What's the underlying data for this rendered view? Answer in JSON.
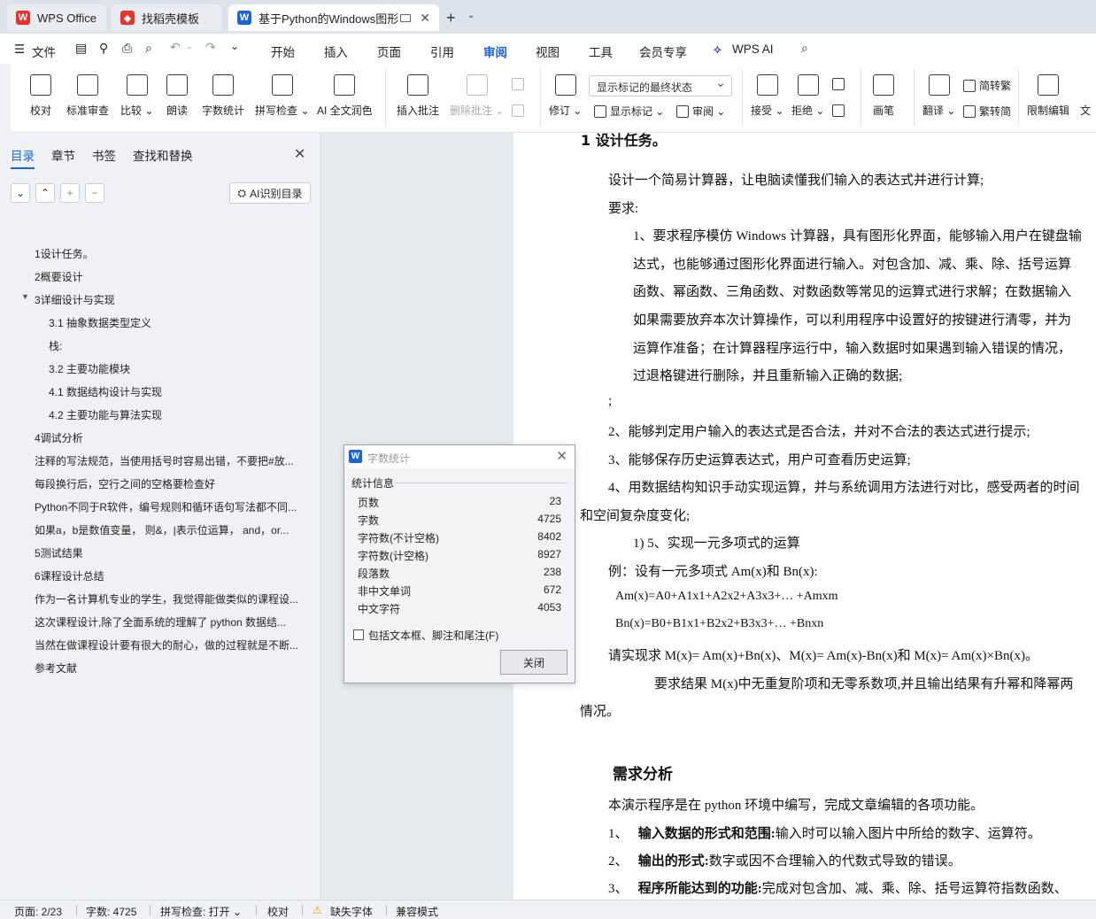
{
  "tabs": {
    "wps": "WPS Office",
    "template": "找稻壳模板",
    "doc": "基于Python的Windows图形"
  },
  "menu": {
    "file": "文件",
    "items": [
      "开始",
      "插入",
      "页面",
      "引用",
      "审阅",
      "视图",
      "工具",
      "会员专享",
      "WPS AI"
    ],
    "active": "审阅"
  },
  "ribbon": {
    "proofread": "校对",
    "standard_review": "标准审查",
    "compare": "比较",
    "read_aloud": "朗读",
    "word_count": "字数统计",
    "spell_check": "拼写检查",
    "ai_polish": "AI 全文润色",
    "insert_comment": "插入批注",
    "delete_comment": "删除批注",
    "revise": "修订",
    "show_markup": "显示标记",
    "review": "审阅",
    "markup_mode": "显示标记的最终状态",
    "accept": "接受",
    "reject": "拒绝",
    "pen": "画笔",
    "translate": "翻译",
    "to_trad": "简转繁",
    "to_simp": "繁转简",
    "restrict": "限制编辑",
    "doc_cut": "文"
  },
  "panel": {
    "tabs": [
      "目录",
      "章节",
      "书签",
      "查找和替换"
    ],
    "ai_toc": "AI识别目录",
    "toc": [
      "1设计任务。",
      "2概要设计",
      "3详细设计与实现",
      "3.1 抽象数据类型定义",
      "栈:",
      "3.2  主要功能模块",
      "4.1  数据结构设计与实现",
      "4.2  主要功能与算法实现",
      "4调试分析",
      "注释的写法规范，当使用括号时容易出错，不要把#放...",
      "每段换行后，空行之间的空格要检查好",
      "Python不同于R软件，编号规则和循环语句写法都不同...",
      "如果a，b是数值变量，  则&，|表示位运算，  and，or...",
      "5测试结果",
      "6课程设计总结",
      "作为一名计算机专业的学生，我觉得能做类似的课程设...",
      "这次课程设计,除了全面系统的理解了 python 数据结...",
      "当然在做课程设计要有很大的耐心，做的过程就是不断...",
      "参考文献"
    ]
  },
  "document": {
    "heading": "1  设计任务。",
    "p1": "设计一个简易计算器，让电脑读懂我们输入的表达式并进行计算;",
    "p2": "要求:",
    "r1": "1、要求程序模仿 Windows 计算器，具有图形化界面，能够输入用户在键盘输",
    "r2": "达式，也能够通过图形化界面进行输入。对包含加、减、乘、除、括号运算",
    "r3": "函数、幂函数、三角函数、对数函数等常见的运算式进行求解；在数据输入",
    "r4": "如果需要放弃本次计算操作，可以利用程序中设置好的按键进行清零，并为",
    "r5": "运算作准备；在计算器程序运行中，输入数据时如果遇到输入错误的情况，",
    "r6": "过退格键进行删除，并且重新输入正确的数据;",
    "semi": ";",
    "i2": "2、能够判定用户输入的表达式是否合法，并对不合法的表达式进行提示;",
    "i3": "3、能够保存历史运算表达式，用户可查看历史运算;",
    "i4a": "4、用数据结构知识手动实现运算，并与系统调用方法进行对比，感受两者的时间",
    "i4b": "和空间复杂度变化;",
    "i5": "1)  5、实现一元多项式的运算",
    "ex": "例：设有一元多项式 Am(x)和 Bn(x):",
    "am": "Am(x)=A0+A1x1+A2x2+A3x3+… +Amxm",
    "bn": "Bn(x)=B0+B1x1+B2x2+B3x3+… +Bnxn",
    "impl": "请实现求 M(x)= Am(x)+Bn(x)、M(x)= Am(x)-Bn(x)和 M(x)= Am(x)×Bn(x)。",
    "req": "要求结果 M(x)中无重复阶项和无零系数项,并且输出结果有升幂和降幂两",
    "req2": "情况。",
    "h2": "需求分析",
    "d1": "本演示程序是在 python 环境中编写，完成文章编辑的各项功能。",
    "d2n": "1、",
    "d2b": "输入数据的形式和范围:",
    "d2t": "输入时可以输入图片中所给的数字、运算符。",
    "d3n": "2、",
    "d3b": "输出的形式:",
    "d3t": "数字或因不合理输入的代数式导致的错误。",
    "d4n": "3、",
    "d4b": "程序所能达到的功能:",
    "d4t": "完成对包含加、减、乘、除、括号运算符指数函数、"
  },
  "dialog": {
    "title": "字数统计",
    "group": "统计信息",
    "rows": [
      {
        "label": "页数",
        "value": "23"
      },
      {
        "label": "字数",
        "value": "4725"
      },
      {
        "label": "字符数(不计空格)",
        "value": "8402"
      },
      {
        "label": "字符数(计空格)",
        "value": "8927"
      },
      {
        "label": "段落数",
        "value": "238"
      },
      {
        "label": "非中文单词",
        "value": "672"
      },
      {
        "label": "中文字符",
        "value": "4053"
      }
    ],
    "checkbox": "包括文本框、脚注和尾注(F)",
    "close": "关闭"
  },
  "status": {
    "page": "页面: 2/23",
    "words": "字数: 4725",
    "spell": "拼写检查: 打开",
    "proof": "校对",
    "font": "缺失字体",
    "compat": "兼容模式"
  }
}
